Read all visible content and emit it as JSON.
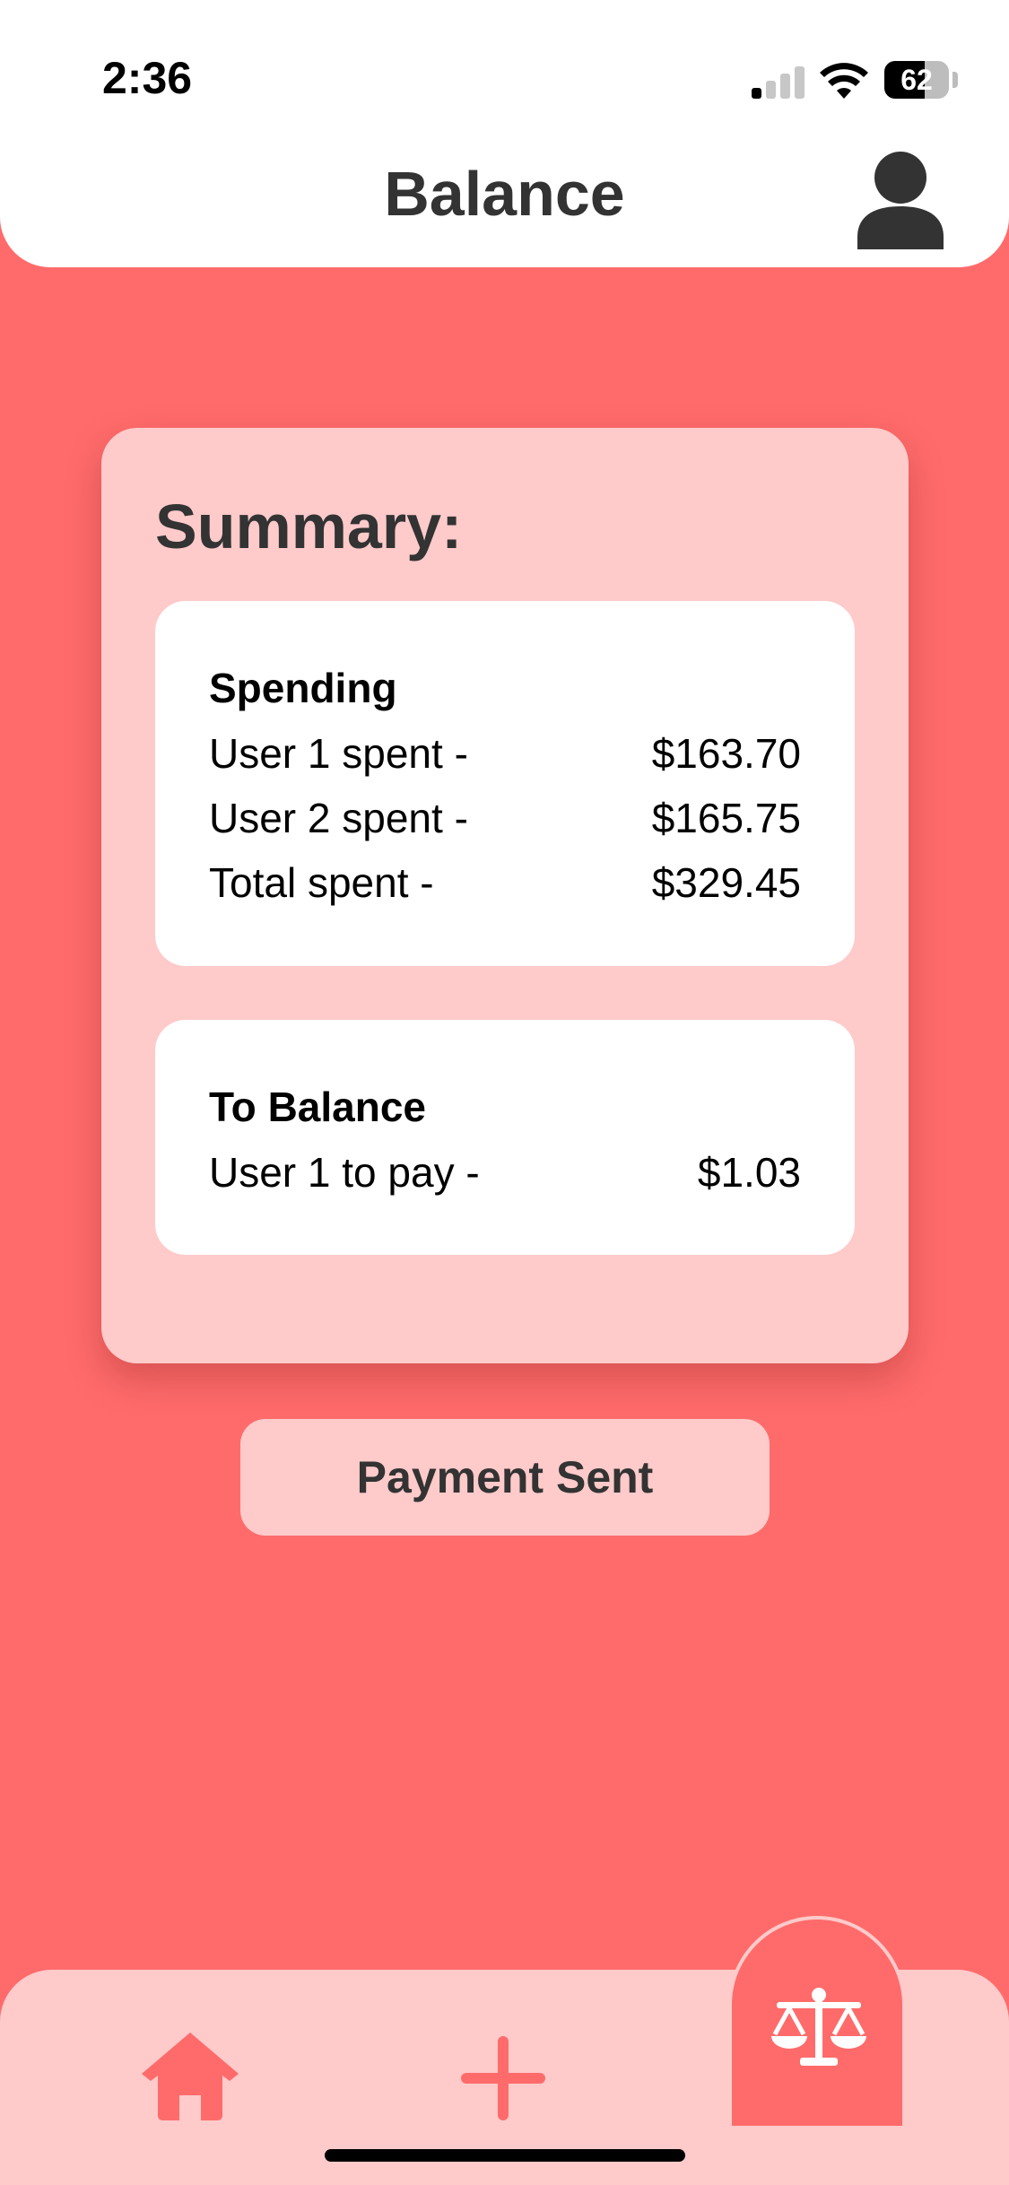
{
  "status_bar": {
    "time": "2:36",
    "battery": "62"
  },
  "header": {
    "title": "Balance",
    "profile_icon": "person-icon"
  },
  "summary": {
    "title": "Summary:",
    "spending": {
      "heading": "Spending",
      "rows": [
        {
          "label": "User 1 spent -",
          "value": "$163.70"
        },
        {
          "label": "User 2 spent -",
          "value": "$165.75"
        },
        {
          "label": "Total spent -",
          "value": "$329.45"
        }
      ]
    },
    "to_balance": {
      "heading": "To Balance",
      "rows": [
        {
          "label": "User 1 to pay -",
          "value": "$1.03"
        }
      ]
    }
  },
  "actions": {
    "payment_sent": "Payment Sent"
  },
  "tab_bar": {
    "items": [
      {
        "name": "home",
        "icon": "home-icon",
        "active": false
      },
      {
        "name": "add",
        "icon": "plus-icon",
        "active": false
      },
      {
        "name": "balance",
        "icon": "scale-icon",
        "active": true
      }
    ]
  },
  "colors": {
    "background": "#FF6B6B",
    "card": "#FFCACA",
    "surface": "#FFFFFF",
    "text": "#333333"
  }
}
